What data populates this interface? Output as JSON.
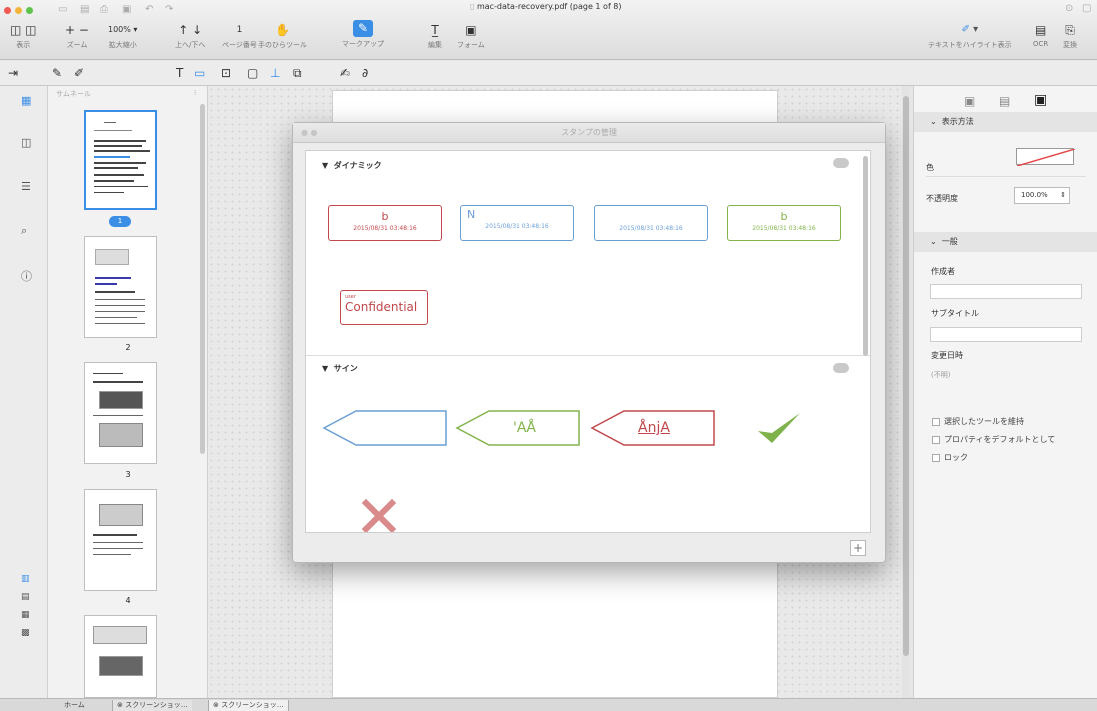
{
  "window": {
    "title": "mac-data-recovery.pdf (page 1 of 8)"
  },
  "colors": {
    "accent": "#3a8ee6",
    "stamp_red": "#c0484c",
    "stamp_blue": "#6a9fd4",
    "stamp_green": "#82b44a",
    "check_green": "#7fb24a",
    "cross_red": "#d98a8a"
  },
  "toolbar": {
    "view_label": "表示",
    "zoom_label": "ズーム",
    "zoom_value": "100%",
    "scale_label": "拡大縮小",
    "updown_label": "上へ/下へ",
    "page_value": "1",
    "page_label": "ページ番号",
    "hand_label": "手のひらツール",
    "markup_label": "マークアップ",
    "edit_label": "編集",
    "form_label": "フォーム",
    "highlight_label": "テキストをハイライト表示",
    "ocr_label": "OCR",
    "convert_label": "変換"
  },
  "sidebar": {
    "thumbnail_label": "サムネール",
    "pages": [
      {
        "num": "1",
        "selected": true
      },
      {
        "num": "2"
      },
      {
        "num": "3"
      },
      {
        "num": "4"
      }
    ]
  },
  "dialog": {
    "title": "スタンプの管理",
    "section_dynamic": "ダイナミック",
    "section_sign": "サイン",
    "dynamic_stamps": [
      {
        "letter": "b",
        "date": "2015/08/31 03:48:16 ",
        "color": "red"
      },
      {
        "letter": "N",
        "date": "2015/08/31 03:48:16 ",
        "color": "blue"
      },
      {
        "letter": "",
        "date": "2015/08/31 03:48:16 ",
        "color": "blue"
      },
      {
        "letter": "b",
        "date": "2015/08/31 03:48:16 ",
        "color": "green"
      }
    ],
    "confidential_small": "user",
    "confidential_text": "Confidential",
    "sign_texts": [
      "",
      "'AÅ",
      "ÅnjA"
    ],
    "add_button": "+"
  },
  "properties": {
    "section_display": "表示方法",
    "color_label": "色",
    "opacity_label": "不透明度",
    "opacity_value": "100.0%",
    "section_general": "一般",
    "author_label": "作成者",
    "subtitle_label": "サブタイトル",
    "modified_label": "変更日時",
    "modified_value": "(不明)",
    "check_keep_tool": "選択したツールを維持",
    "check_default_props": "プロパティをデフォルトとして",
    "check_lock": "ロック"
  },
  "bottom_tabs": [
    "ホーム",
    "スクリーンショッ…",
    "スクリーンショッ…"
  ]
}
